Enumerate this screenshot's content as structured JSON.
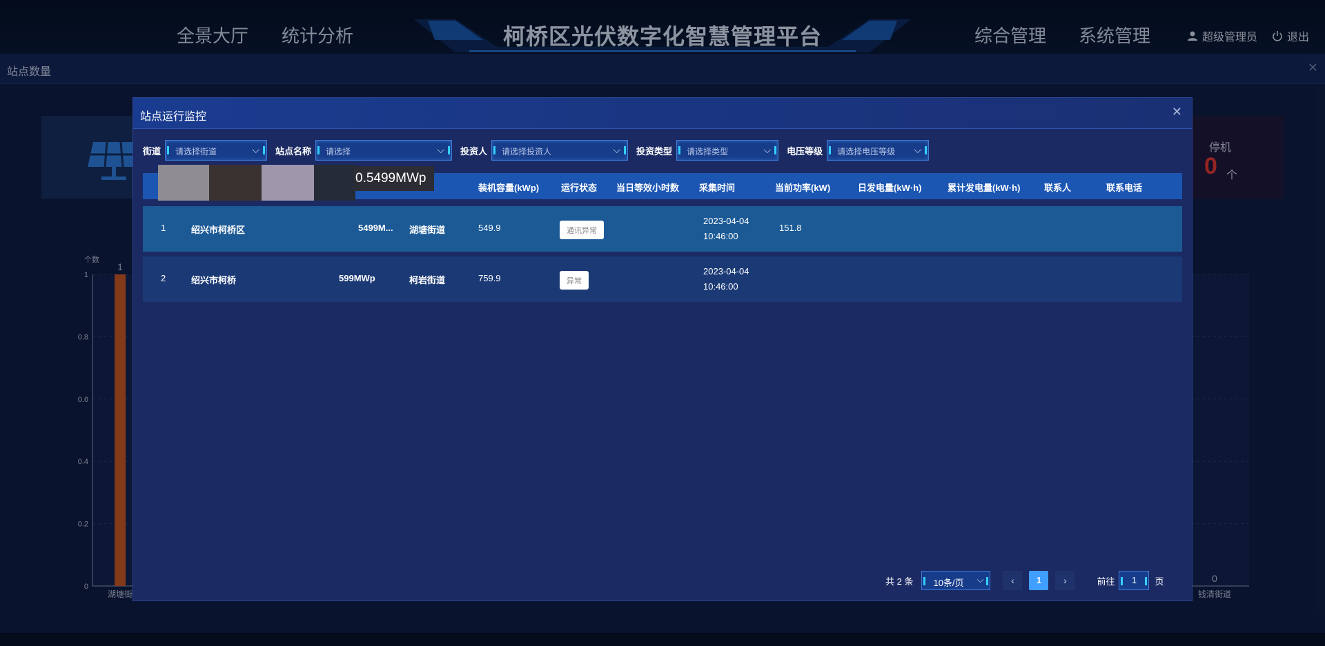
{
  "header": {
    "nav_left": [
      "全景大厅",
      "统计分析"
    ],
    "title": "柯桥区光伏数字化智慧管理平台",
    "nav_right": [
      "综合管理",
      "系统管理"
    ],
    "user": "超级管理员",
    "logout": "退出"
  },
  "background": {
    "panel_title": "站点数量",
    "stop_label": "停机",
    "stop_value": "0",
    "stop_unit": "个",
    "chart_data": {
      "type": "bar",
      "ylabel": "个数",
      "ylim": [
        0,
        1
      ],
      "yticks": [
        "1",
        "0.8",
        "0.6",
        "0.4",
        "0.2",
        "0"
      ],
      "categories": [
        "湖塘街道",
        "钱清街道"
      ],
      "values": [
        1,
        0
      ],
      "data_labels": [
        "1",
        "0"
      ],
      "bar_color": "#c85a2a",
      "x_labels_visible": [
        "湖塘街",
        "钱清街道"
      ]
    }
  },
  "modal": {
    "title": "站点运行监控",
    "filters": [
      {
        "label": "街道",
        "placeholder": "请选择街道"
      },
      {
        "label": "站点名称",
        "placeholder": "请选择"
      },
      {
        "label": "投资人",
        "placeholder": "请选择投资人"
      },
      {
        "label": "投资类型",
        "placeholder": "请选择类型"
      },
      {
        "label": "电压等级",
        "placeholder": "请选择电压等级"
      }
    ],
    "tooltip": "0.5499MWp",
    "columns": [
      "装机容量(kWp)",
      "运行状态",
      "当日等效小时数",
      "采集时间",
      "当前功率(kW)",
      "日发电量(kW·h)",
      "累计发电量(kW·h)",
      "联系人",
      "联系电话"
    ],
    "rows": [
      {
        "index": "1",
        "name": "绍兴市柯桥区",
        "capacity_label": "5499M...",
        "street": "湖塘街道",
        "capacity": "549.9",
        "status": "通讯异常",
        "hours": "",
        "time_date": "2023-04-04",
        "time_clock": "10:46:00",
        "power": "151.8",
        "daily": "",
        "total": "",
        "contact": "",
        "phone": ""
      },
      {
        "index": "2",
        "name": "绍兴市柯桥",
        "capacity_label": "599MWp",
        "street": "柯岩街道",
        "capacity": "759.9",
        "status": "异常",
        "hours": "",
        "time_date": "2023-04-04",
        "time_clock": "10:46:00",
        "power": "",
        "daily": "",
        "total": "",
        "contact": "",
        "phone": ""
      }
    ],
    "pagination": {
      "total": "共 2 条",
      "page_size": "10条/页",
      "prev": "‹",
      "current": "1",
      "next": "›",
      "goto_label": "前往",
      "goto_value": "1",
      "goto_suffix": "页"
    }
  },
  "colors": {
    "accent": "#409eff",
    "table_header": "#1b56b3",
    "row_selected": "#1c5a96",
    "stop_red": "#e53935"
  }
}
